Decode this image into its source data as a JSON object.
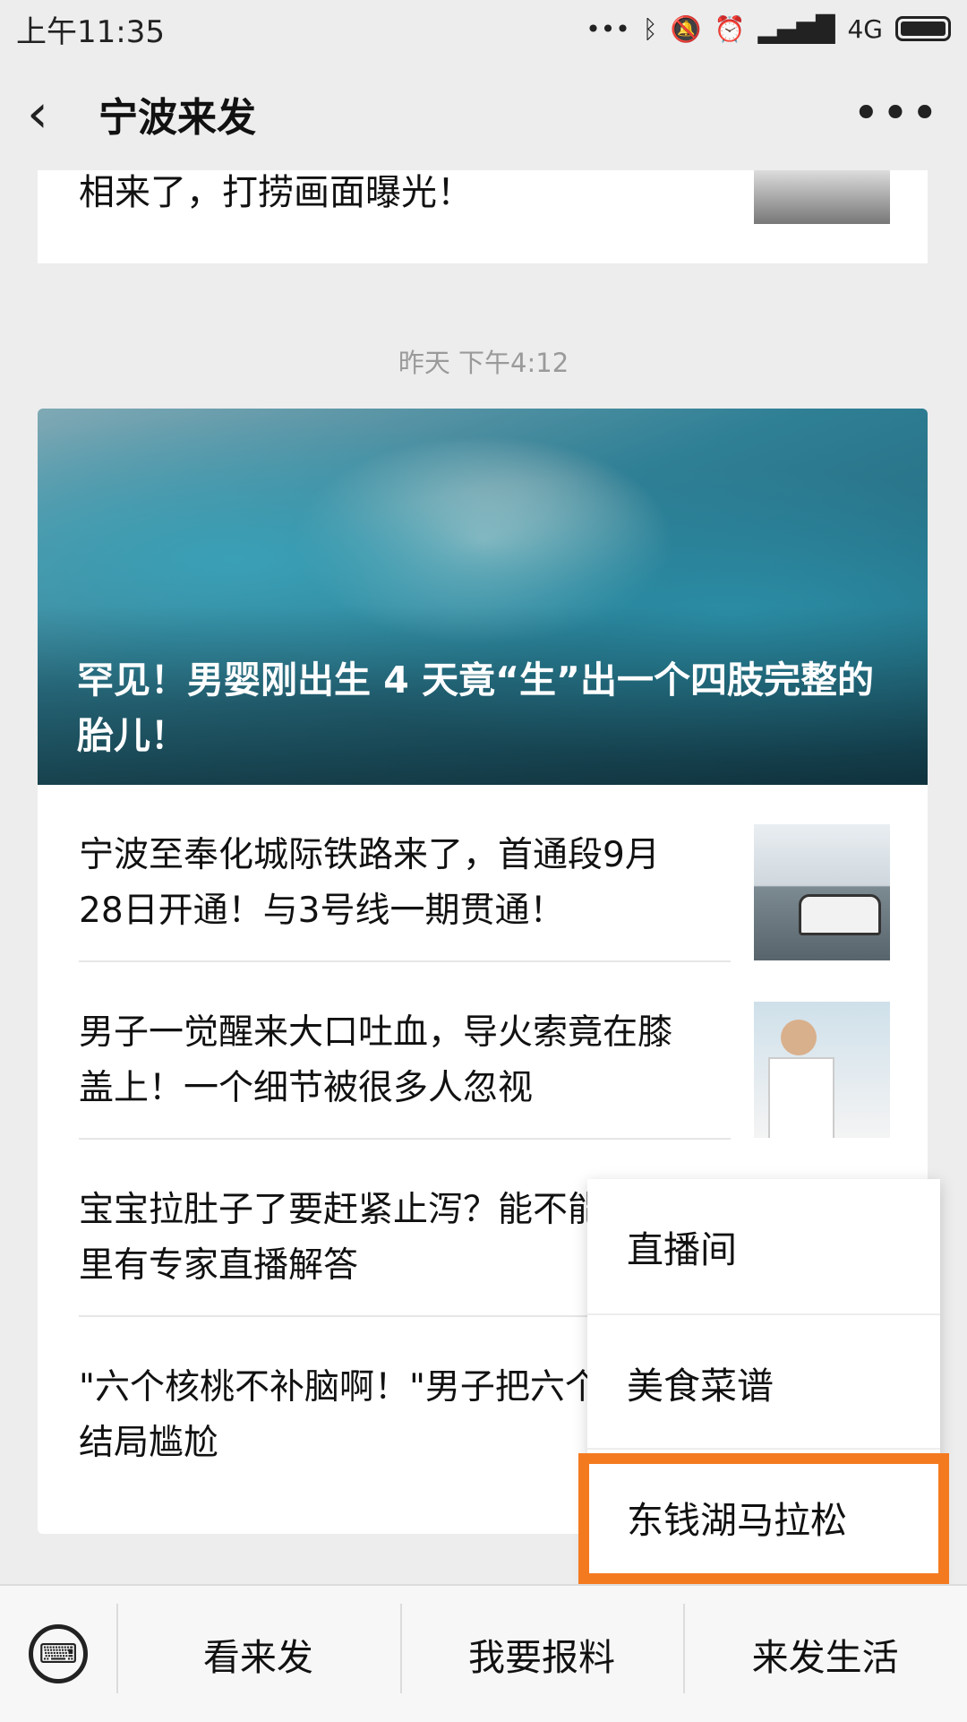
{
  "status_bar": {
    "time": "上午11:35",
    "icons": [
      "more-dots-icon",
      "bluetooth-icon",
      "mute-icon",
      "alarm-icon",
      "signal-icon",
      "battery-icon"
    ],
    "network": "4G"
  },
  "header": {
    "back_icon": "‹",
    "title": "宁波来发",
    "more_icon": "•••"
  },
  "previous_card": {
    "title": "相来了，打捞画面曝光！"
  },
  "timestamp": "昨天 下午4:12",
  "hero": {
    "title": "罕见！男婴刚出生 4 天竟“生”出一个四肢完整的胎儿！"
  },
  "articles": [
    {
      "title": "宁波至奉化城际铁路来了，首通段9月28日开通！与3号线一期贯通！"
    },
    {
      "title": "男子一觉醒来大口吐血，导火索竟在膝盖上！一个细节被很多人忽视"
    },
    {
      "title": "宝宝拉肚子了要赶紧止泻？能不能喝水？别慌，这里有专家直播解答"
    },
    {
      "title": "\"六个核桃不补脑啊！\"男子把六个核桃告上法庭！结局尴尬"
    }
  ],
  "menu_popup": {
    "items": [
      "直播间",
      "美食菜谱",
      "东钱湖马拉松"
    ],
    "highlight_color": "#f47a20"
  },
  "bottom_bar": {
    "keyboard_icon": "⌨",
    "tabs": [
      "看来发",
      "我要报料",
      "来发生活"
    ]
  }
}
